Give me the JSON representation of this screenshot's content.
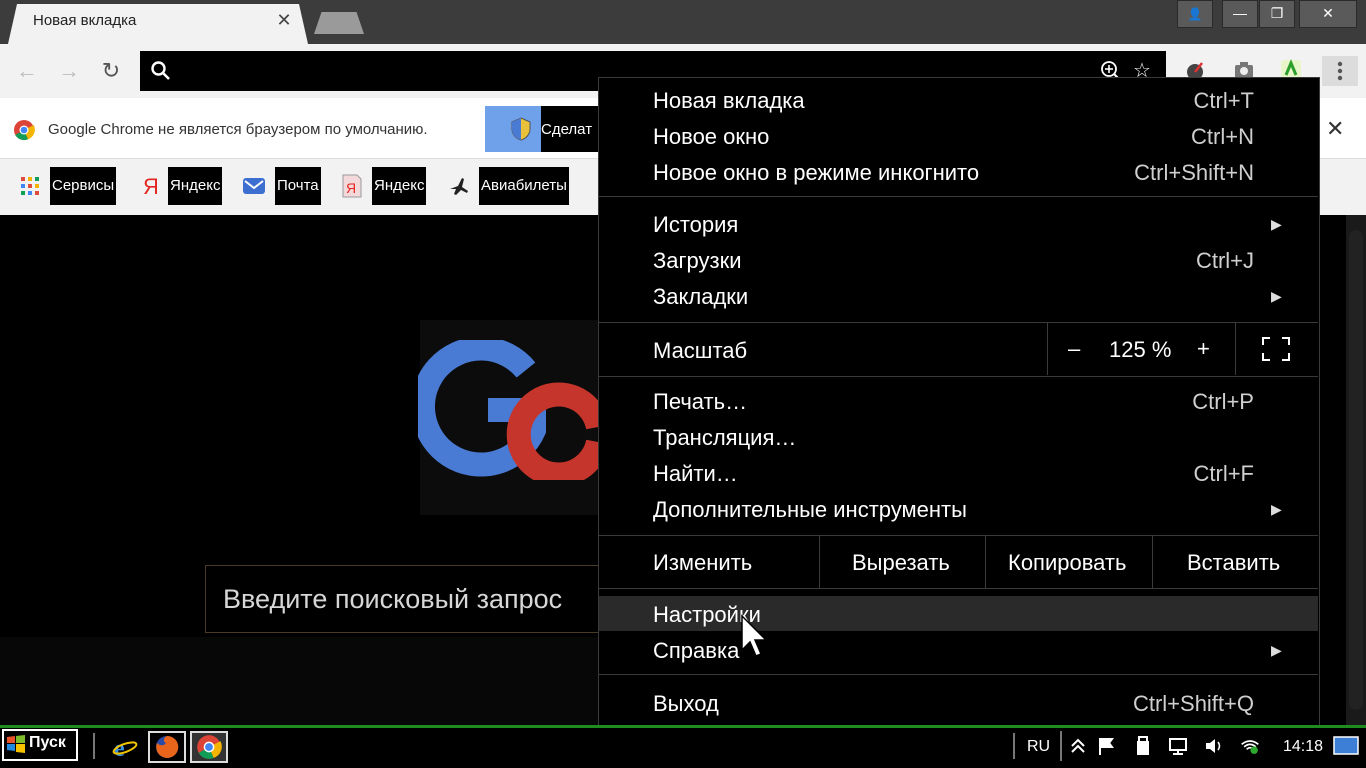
{
  "window": {
    "tab_title": "Новая вкладка",
    "tab_close": "✕",
    "controls": {
      "user": "👤",
      "minimize": "—",
      "restore": "❐",
      "close": "✕"
    }
  },
  "toolbar": {
    "back": "←",
    "forward": "→",
    "reload": "↻",
    "star": "☆"
  },
  "infobar": {
    "text": "Google Chrome не является браузером по умолчанию.",
    "default_button": "Сделат",
    "close": "✕"
  },
  "bookmarks": [
    {
      "label": "Сервисы",
      "icon": "apps-grid-icon"
    },
    {
      "label": "Яндекс",
      "icon": "yandex-icon"
    },
    {
      "label": "Почта",
      "icon": "mail-icon"
    },
    {
      "label": "Яндекс",
      "icon": "yandex-browser-icon"
    },
    {
      "label": "Авиабилеты",
      "icon": "airplane-icon"
    }
  ],
  "page": {
    "search_placeholder": "Введите поисковый запрос"
  },
  "menu": {
    "new_tab": {
      "label": "Новая вкладка",
      "shortcut": "Ctrl+T"
    },
    "new_window": {
      "label": "Новое окно",
      "shortcut": "Ctrl+N"
    },
    "incognito": {
      "label": "Новое окно в режиме инкогнито",
      "shortcut": "Ctrl+Shift+N"
    },
    "history": {
      "label": "История"
    },
    "downloads": {
      "label": "Загрузки",
      "shortcut": "Ctrl+J"
    },
    "bookmarks": {
      "label": "Закладки"
    },
    "zoom": {
      "label": "Масштаб",
      "minus": "–",
      "value": "125 %",
      "plus": "+"
    },
    "print": {
      "label": "Печать…",
      "shortcut": "Ctrl+P"
    },
    "cast": {
      "label": "Трансляция…"
    },
    "find": {
      "label": "Найти…",
      "shortcut": "Ctrl+F"
    },
    "more_tools": {
      "label": "Дополнительные инструменты"
    },
    "edit": {
      "label": "Изменить",
      "cut": "Вырезать",
      "copy": "Копировать",
      "paste": "Вставить"
    },
    "settings": {
      "label": "Настройки"
    },
    "help": {
      "label": "Справка"
    },
    "exit": {
      "label": "Выход",
      "shortcut": "Ctrl+Shift+Q"
    }
  },
  "taskbar": {
    "start": "Пуск",
    "lang": "RU",
    "clock": "14:18"
  },
  "colors": {
    "accent_green": "#1e8c1e",
    "google_blue": "#4a7bd4",
    "google_red": "#c5352c",
    "infobar_button": "#6fa0ea"
  }
}
